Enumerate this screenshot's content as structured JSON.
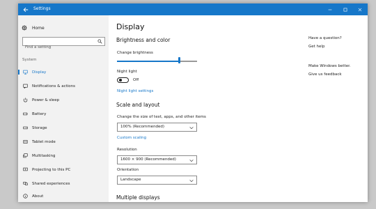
{
  "window": {
    "title": "Settings"
  },
  "sidebar": {
    "home_label": "Home",
    "search_placeholder": "Find a setting",
    "section_label": "System",
    "items": [
      {
        "label": "Display",
        "icon": "monitor-icon",
        "selected": true
      },
      {
        "label": "Notifications & actions",
        "icon": "notification-icon"
      },
      {
        "label": "Power & sleep",
        "icon": "power-icon"
      },
      {
        "label": "Battery",
        "icon": "battery-icon"
      },
      {
        "label": "Storage",
        "icon": "storage-icon"
      },
      {
        "label": "Tablet mode",
        "icon": "tablet-icon"
      },
      {
        "label": "Multitasking",
        "icon": "multitasking-icon"
      },
      {
        "label": "Projecting to this PC",
        "icon": "projecting-icon"
      },
      {
        "label": "Shared experiences",
        "icon": "shared-icon"
      },
      {
        "label": "About",
        "icon": "info-icon"
      }
    ]
  },
  "main": {
    "title": "Display",
    "brightness_heading": "Brightness and color",
    "brightness_label": "Change brightness",
    "brightness_level": 0.77,
    "night_light_label": "Night light",
    "night_light_state": "Off",
    "night_light_settings_link": "Night light settings",
    "scale_heading": "Scale and layout",
    "scale_label": "Change the size of text, apps, and other items",
    "scale_value": "100% (Recommended)",
    "custom_scaling_link": "Custom scaling",
    "resolution_label": "Resolution",
    "resolution_value": "1600 × 900 (Recommended)",
    "orientation_label": "Orientation",
    "orientation_value": "Landscape",
    "multiple_displays_heading": "Multiple displays"
  },
  "aside": {
    "question_label": "Have a question?",
    "get_help_link": "Get help",
    "feedback_prompt": "Make Windows better.",
    "feedback_link": "Give us feedback"
  },
  "colors": {
    "accent": "#1677c9",
    "titlebar": "#1677c9",
    "sidebar_bg": "#f2f2f2",
    "backdrop": "#c9c9c9"
  }
}
